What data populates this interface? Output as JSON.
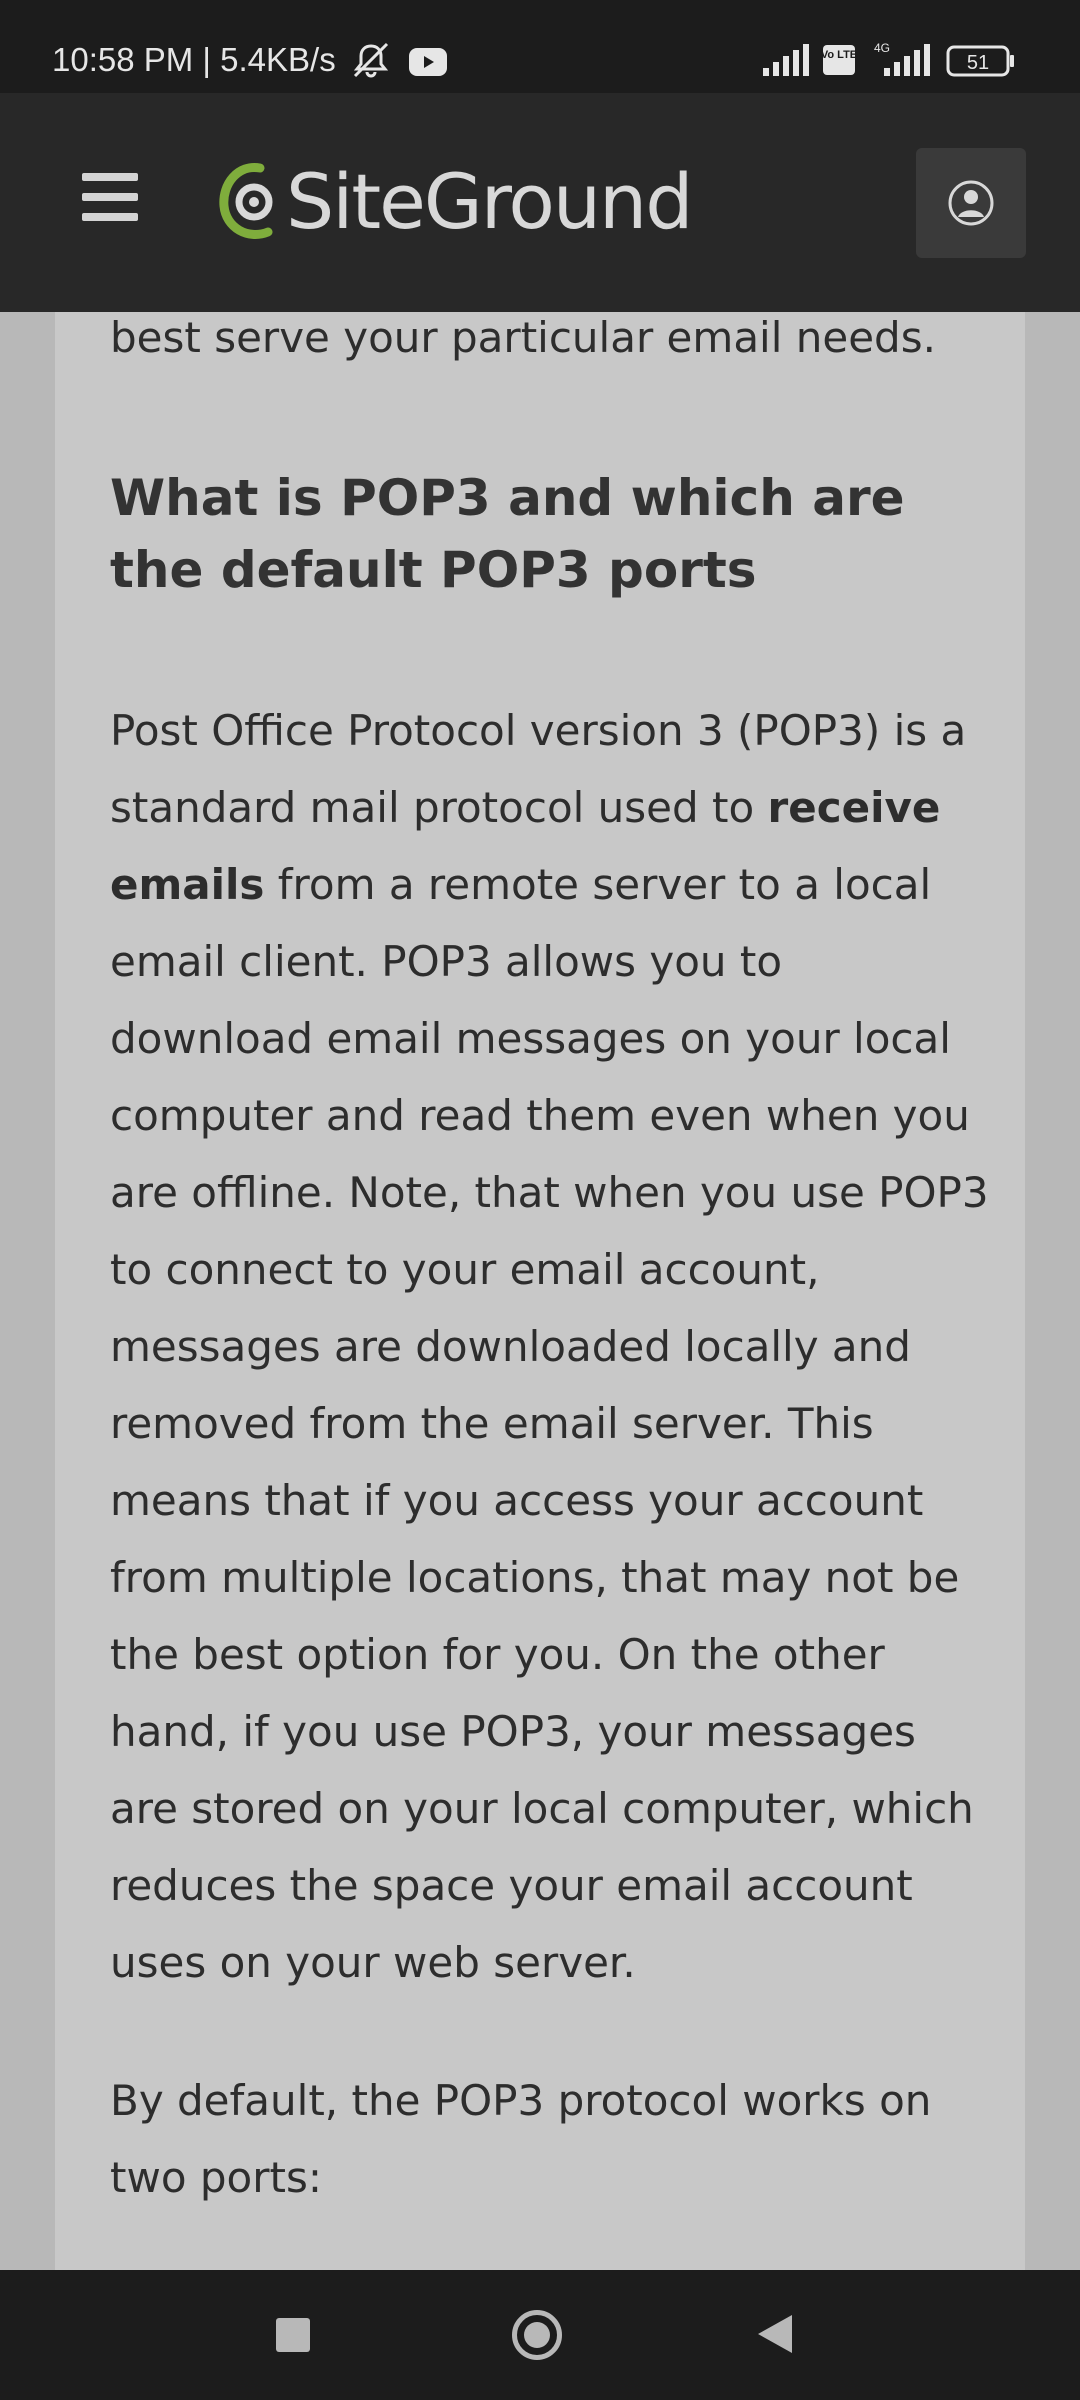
{
  "status_bar": {
    "time_speed": "10:58 PM | 5.4KB/s",
    "network_label": "4G",
    "volte_label": "Vo LTE",
    "battery": "51",
    "icons": [
      "muted-bell-icon",
      "youtube-icon",
      "signal-icon",
      "volte-icon",
      "signal-4g-icon",
      "battery-icon"
    ]
  },
  "header": {
    "logo_text": "SiteGround",
    "logo_color": "#7fad3c",
    "icons": [
      "menu-icon",
      "account-icon"
    ]
  },
  "article": {
    "top_line": "best serve your particular email needs.",
    "heading": "What is POP3 and which are the default POP3 ports",
    "para1_a": "Post Office Protocol version 3 (POP3) is a standard mail protocol used to ",
    "para1_bold": "receive emails",
    "para1_b": " from a remote server to a local email client. POP3 allows you to download email messages on your local computer and read them even when you are offline. Note, that when you use POP3 to connect to your email account, messages are downloaded locally and removed from the email server. This means that if you access your account from multiple locations, that may not be the best option for you. On the other hand, if you use POP3, your messages are stored on your local computer, which reduces the space your email account uses on your web server.",
    "para2": "By default, the POP3 protocol works on two ports:"
  },
  "nav_bar": {
    "icons": [
      "recents-icon",
      "home-icon",
      "back-icon"
    ]
  }
}
